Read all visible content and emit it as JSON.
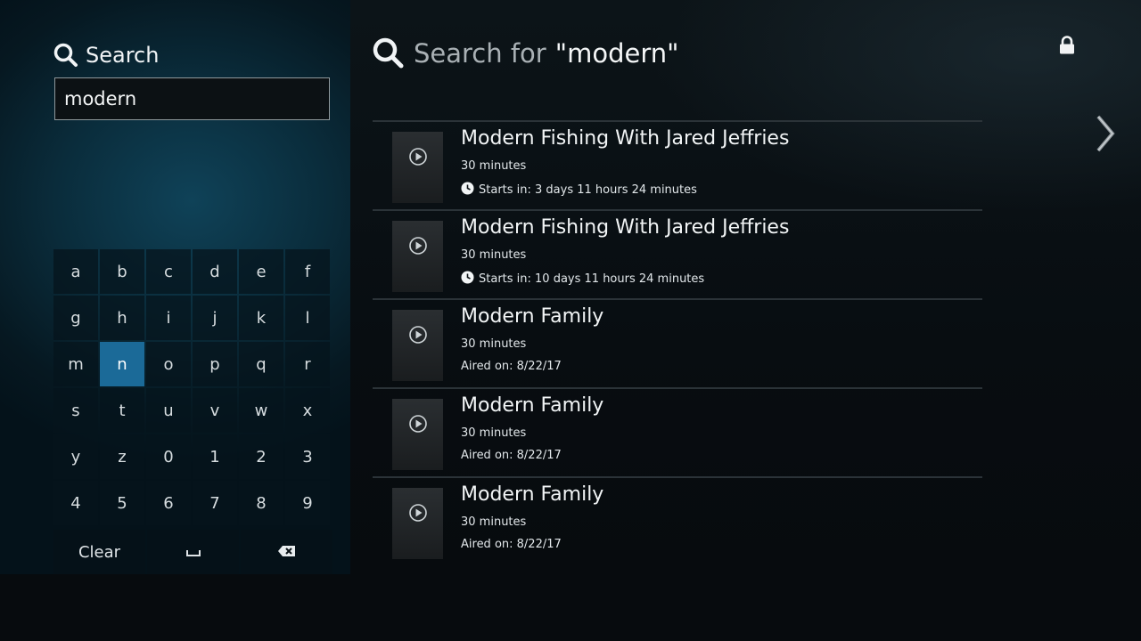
{
  "search_panel": {
    "title": "Search",
    "query": "modern"
  },
  "keyboard": {
    "keys": [
      "a",
      "b",
      "c",
      "d",
      "e",
      "f",
      "g",
      "h",
      "i",
      "j",
      "k",
      "l",
      "m",
      "n",
      "o",
      "p",
      "q",
      "r",
      "s",
      "t",
      "u",
      "v",
      "w",
      "x",
      "y",
      "z",
      "0",
      "1",
      "2",
      "3",
      "4",
      "5",
      "6",
      "7",
      "8",
      "9"
    ],
    "active_key": "n",
    "clear_label": "Clear",
    "space_icon": "space-icon",
    "backspace_icon": "backspace-icon"
  },
  "results_header": {
    "prefix": "Search for",
    "query": "\"modern\""
  },
  "icons": {
    "lock": "lock-icon",
    "next": "chevron-right-icon",
    "play": "play-icon",
    "clock": "clock-icon",
    "search": "search-icon"
  },
  "colors": {
    "accent": "#1b6a98",
    "text": "#f2f5f6"
  },
  "results": [
    {
      "title": "Modern Fishing With Jared Jeffries",
      "duration": "30 minutes",
      "meta": "Starts in: 3 days 11 hours 24 minutes",
      "upcoming": true
    },
    {
      "title": "Modern Fishing With Jared Jeffries",
      "duration": "30 minutes",
      "meta": "Starts in: 10 days 11 hours 24 minutes",
      "upcoming": true
    },
    {
      "title": "Modern Family",
      "duration": "30 minutes",
      "meta": "Aired on: 8/22/17",
      "upcoming": false
    },
    {
      "title": "Modern Family",
      "duration": "30 minutes",
      "meta": "Aired on: 8/22/17",
      "upcoming": false
    },
    {
      "title": "Modern Family",
      "duration": "30 minutes",
      "meta": "Aired on: 8/22/17",
      "upcoming": false
    }
  ]
}
